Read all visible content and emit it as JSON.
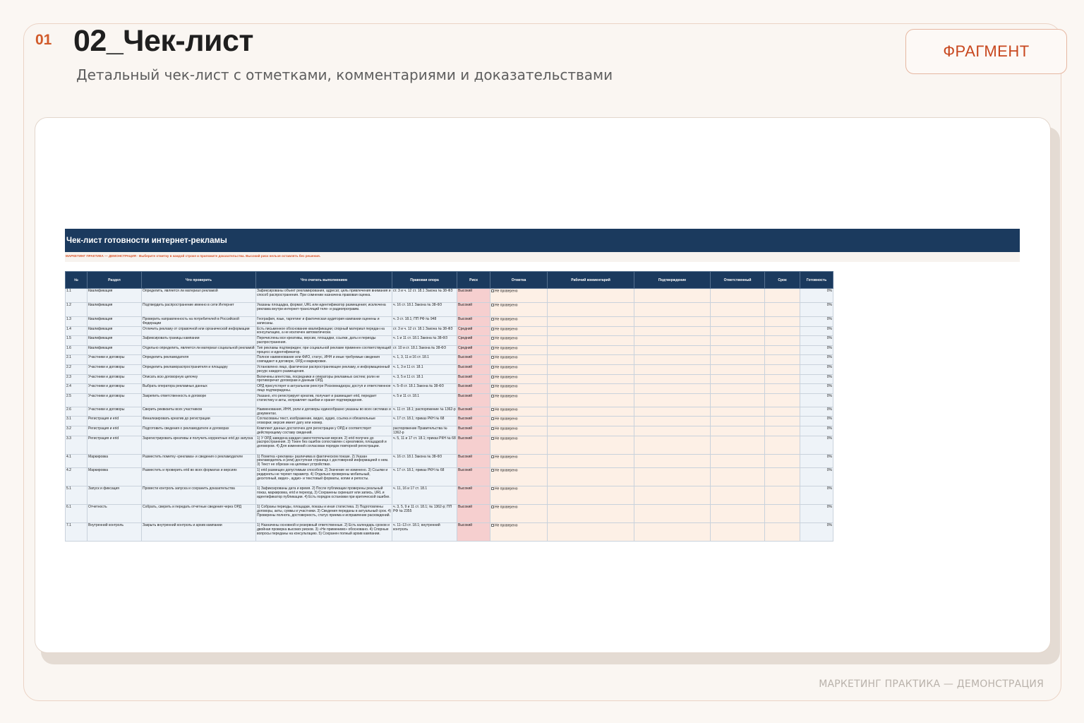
{
  "slide": {
    "number": "01",
    "title": "02_Чек-лист",
    "subtitle": "Детальный чек-лист с отметками, комментариями и доказательствами",
    "badge": "ФРАГМЕНТ",
    "footer": "МАРКЕТИНГ ПРАКТИКА — ДЕМОНСТРАЦИЯ"
  },
  "sheet": {
    "title": "Чек-лист готовности интернет-рекламы",
    "note": "МАРКЕТИНГ ПРАКТИКА — ДЕМОНСТРАЦИЯ · Выберите отметку в каждой строке и приложите доказательства. Высокий риск нельзя оставлять без решения.",
    "columns": [
      "№",
      "Раздел",
      "Что проверить",
      "Что считать выполнением",
      "Правовая опора",
      "Риск",
      "Отметка",
      "Рабочий комментарий",
      "Подтверждение",
      "Ответственный",
      "Срок",
      "Готовность"
    ],
    "rows": [
      {
        "n": "1.1",
        "section": "Квалификация",
        "check": "Определить, является ли материал рекламой",
        "done": "Зафиксированы объект рекламирования, адресат, цель привлечения внимания и способ распространения. При сомнении назначена правовая оценка.",
        "law": "ст. 3 и ч. 12 ст. 18.1 Закона № 38-ФЗ",
        "risk": "Высокий",
        "mark": "Не проверено",
        "pct": "0%"
      },
      {
        "n": "1.2",
        "section": "Квалификация",
        "check": "Подтвердить распространение именно в сети Интернет",
        "done": "Указаны площадка, формат, URL или идентификатор размещения; исключена реклама внутри интернет-трансляций теле- и радиопрограмм.",
        "law": "ч. 16 ст. 18.1 Закона № 38-ФЗ",
        "risk": "Высокий",
        "mark": "Не проверено",
        "pct": "0%"
      },
      {
        "n": "1.3",
        "section": "Квалификация",
        "check": "Проверить направленность на потребителей в Российской Федерации",
        "done": "География, язык, таргетинг и фактическая аудитория кампании оценены и записаны.",
        "law": "ч. 3 ст. 18.1; ПП РФ № 948",
        "risk": "Высокий",
        "mark": "Не проверено",
        "pct": "0%"
      },
      {
        "n": "1.4",
        "section": "Квалификация",
        "check": "Отличить рекламу от справочной или органической информации",
        "done": "Есть письменное обоснование квалификации; спорный материал передан на консультацию, а не исключен автоматически.",
        "law": "ст. 3 и ч. 12 ст. 18.1 Закона № 38-ФЗ",
        "risk": "Средний",
        "mark": "Не проверено",
        "pct": "0%"
      },
      {
        "n": "1.5",
        "section": "Квалификация",
        "check": "Зафиксировать границы кампании",
        "done": "Перечислены все креативы, версии, площадки, ссылки, даты и периоды распространения.",
        "law": "ч. 1 и 11 ст. 18.1 Закона № 38-ФЗ",
        "risk": "Средний",
        "mark": "Не проверено",
        "pct": "0%"
      },
      {
        "n": "1.6",
        "section": "Квалификация",
        "check": "Отдельно определить, является ли материал социальной рекламой",
        "done": "Тип рекламы подтвержден; при социальной рекламе применен соответствующий процесс и идентификатор.",
        "law": "ст. 10 и ст. 18.1 Закона № 38-ФЗ",
        "risk": "Средний",
        "mark": "Не проверено",
        "pct": "0%"
      },
      {
        "n": "2.1",
        "section": "Участники и договоры",
        "check": "Определить рекламодателя",
        "done": "Полное наименование или ФИО, статус, ИНН и иные требуемые сведения совпадают в договоре, ОРД и маркировке.",
        "law": "ч. 1, 3, 11 и 16 ст. 18.1",
        "risk": "Высокий",
        "mark": "Не проверено",
        "pct": "0%"
      },
      {
        "n": "2.2",
        "section": "Участники и договоры",
        "check": "Определить рекламораспространителя и площадку",
        "done": "Установлено лицо, фактически распространяющее рекламу, и информационный ресурс каждого размещения.",
        "law": "ч. 1, 3 и 11 ст. 18.1",
        "risk": "Высокий",
        "mark": "Не проверено",
        "pct": "0%"
      },
      {
        "n": "2.3",
        "section": "Участники и договоры",
        "check": "Описать всю договорную цепочку",
        "done": "Включены агентства, посредники и операторы рекламных систем; роли не противоречат договорам и данным ОРД.",
        "law": "ч. 3, 5 и 11 ст. 18.1",
        "risk": "Высокий",
        "mark": "Не проверено",
        "pct": "0%"
      },
      {
        "n": "2.4",
        "section": "Участники и договоры",
        "check": "Выбрать оператора рекламных данных",
        "done": "ОРД присутствует в актуальном реестре Роскомнадзора; доступ и ответственное лицо подтверждены.",
        "law": "ч. 5–8 ст. 18.1 Закона № 38-ФЗ",
        "risk": "Высокий",
        "mark": "Не проверено",
        "pct": "0%"
      },
      {
        "n": "2.5",
        "section": "Участники и договоры",
        "check": "Закрепить ответственность в договоре",
        "done": "Указано, кто регистрирует креатив, получает и размещает erid, передает статистику и акты, исправляет ошибки и хранит подтверждения.",
        "law": "ч. 5 и 11 ст. 18.1",
        "risk": "Высокий",
        "mark": "Не проверено",
        "pct": "0%"
      },
      {
        "n": "2.6",
        "section": "Участники и договоры",
        "check": "Сверить реквизиты всех участников",
        "done": "Наименования, ИНН, роли и договоры единообразно указаны во всех системах и документах.",
        "law": "ч. 11 ст. 18.1; распоряжение № 1362-р",
        "risk": "Высокий",
        "mark": "Не проверено",
        "pct": "0%"
      },
      {
        "n": "3.1",
        "section": "Регистрация и erid",
        "check": "Финализировать креатив до регистрации",
        "done": "Согласованы текст, изображение, видео, аудио, ссылка и обязательные оговорки; версия имеет дату или номер.",
        "law": "ч. 17 ст. 18.1; приказ РКН № 68",
        "risk": "Высокий",
        "mark": "Не проверено",
        "pct": "0%"
      },
      {
        "n": "3.2",
        "section": "Регистрация и erid",
        "check": "Подготовить сведения о рекламодателе и договорах",
        "done": "Комплект данных достаточен для регистрации у ОРД и соответствует действующему составу сведений.",
        "law": "распоряжение Правительства № 1362-р",
        "risk": "Высокий",
        "mark": "Не проверено",
        "pct": "0%"
      },
      {
        "n": "3.3",
        "section": "Регистрация и erid",
        "check": "Зарегистрировать креативы и получить корректные erid до запуска",
        "done": "1) У ОРД заведена каждая самостоятельная версия. 2) erid получен до распространения. 3) Токен без ошибок сопоставлен с креативом, площадкой и договором. 4) Для изменений согласован порядок повторной регистрации.",
        "law": "ч. 5, 11 и 17 ст. 18.1; приказ РКН № 68",
        "risk": "Высокий",
        "mark": "Не проверено",
        "pct": "0%"
      },
      {
        "n": "4.1",
        "section": "Маркировка",
        "check": "Разместить пометку «реклама» и сведения о рекламодателе",
        "done": "1) Пометка «реклама» различима в фактическом показе. 2) Указан рекламодатель и (или) доступная страница с достоверной информацией о нем. 3) Текст не обрезан на целевых устройствах.",
        "law": "ч. 16 ст. 18.1 Закона № 38-ФЗ",
        "risk": "Высокий",
        "mark": "Не проверено",
        "pct": "0%"
      },
      {
        "n": "4.2",
        "section": "Маркировка",
        "check": "Разместить и проверить erid во всех форматах и версиях",
        "done": "1) erid размещен допустимым способом. 2) Значение не изменено. 3) Ссылки и редиректы не теряют параметр. 4) Отдельно проверены мобильный, десктопный, видео-, аудио- и текстовый форматы, копии и репосты.",
        "law": "ч. 17 ст. 18.1; приказ РКН № 68",
        "risk": "Высокий",
        "mark": "Не проверено",
        "pct": "0%"
      },
      {
        "n": "5.1",
        "section": "Запуск и фиксация",
        "check": "Провести контроль запуска и сохранить доказательства",
        "done": "1) Зафиксированы дата и время. 2) После публикации проверены реальный показ, маркировка, erid и переход. 3) Сохранены скриншот или запись, URL и идентификатор публикации. 4) Есть порядок остановки при критической ошибке.",
        "law": "ч. 11, 16 и 17 ст. 18.1",
        "risk": "Высокий",
        "mark": "Не проверено",
        "pct": "0%"
      },
      {
        "n": "6.1",
        "section": "Отчетность",
        "check": "Собрать, сверить и передать отчетные сведения через ОРД",
        "done": "1) Собраны периоды, площадки, показы и иная статистика. 2) Подготовлены договоры, акты, суммы и участники. 3) Сведения переданы в актуальный срок. 4) Проверены полнота, достоверность, статус приема и исправление расхождений.",
        "law": "ч. 3, 5, 9 и 11 ст. 18.1; № 1362-р; ПП РФ № 2355",
        "risk": "Высокий",
        "mark": "Не проверено",
        "pct": "0%"
      },
      {
        "n": "7.1",
        "section": "Внутренний контроль",
        "check": "Закрыть внутренний контроль и архив кампании",
        "done": "1) Назначены основной и резервный ответственные. 2) Есть календарь сроков и двойная проверка высоких рисков. 3) «Не применимо» обосновано. 4) Спорные вопросы переданы на консультацию. 5) Сохранен полный архив кампании.",
        "law": "ч. 11–13 ст. 18.1; внутренний контроль",
        "risk": "Высокий",
        "mark": "Не проверено",
        "pct": "0%"
      }
    ]
  }
}
